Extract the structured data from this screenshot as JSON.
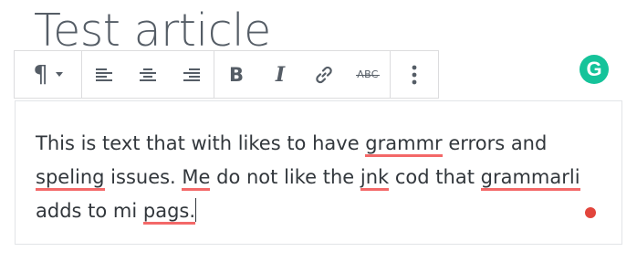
{
  "article": {
    "title": "Test article"
  },
  "toolbar": {
    "paragraph_icon": "¶",
    "buttons": [
      {
        "name": "paragraph-block-switcher",
        "icon": "pilcrow-icon"
      },
      {
        "name": "align-left",
        "icon": "align-left-icon"
      },
      {
        "name": "align-center",
        "icon": "align-center-icon"
      },
      {
        "name": "align-right",
        "icon": "align-right-icon"
      },
      {
        "name": "bold",
        "label": "B"
      },
      {
        "name": "italic",
        "label": "I"
      },
      {
        "name": "link",
        "icon": "link-icon"
      },
      {
        "name": "strikethrough",
        "label": "ABC"
      },
      {
        "name": "more-options",
        "icon": "vertical-ellipsis-icon"
      }
    ],
    "bold_label": "B",
    "italic_label": "I",
    "strike_label": "ABC"
  },
  "editor": {
    "segments": [
      {
        "text": "This is text that with likes to have ",
        "error": false
      },
      {
        "text": "grammr",
        "error": true
      },
      {
        "text": " errors and ",
        "error": false
      },
      {
        "text": "speling",
        "error": true
      },
      {
        "text": " issues. ",
        "error": false
      },
      {
        "text": "Me",
        "error": true
      },
      {
        "text": " do not like the ",
        "error": false
      },
      {
        "text": "jnk",
        "error": true
      },
      {
        "text": " cod that ",
        "error": false
      },
      {
        "text": "grammarli",
        "error": true
      },
      {
        "text": " adds to mi ",
        "error": false
      },
      {
        "text": "pags.",
        "error": true
      }
    ]
  },
  "grammarly": {
    "badge_letter": "G",
    "badge_color": "#15c39a",
    "status_dot_color": "#e2453c"
  },
  "colors": {
    "error_underline": "#f36868",
    "text": "#32373c",
    "toolbar_icon": "#555d66"
  }
}
